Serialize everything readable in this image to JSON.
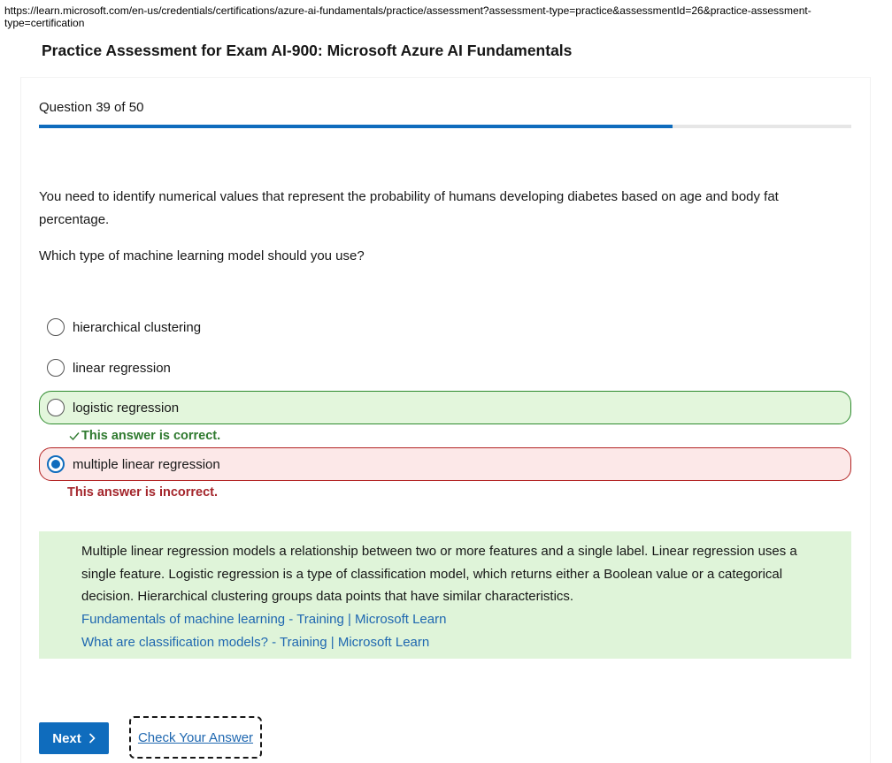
{
  "browser": {
    "url": "https://learn.microsoft.com/en-us/credentials/certifications/azure-ai-fundamentals/practice/assessment?assessment-type=practice&assessmentId=26&practice-assessment-type=certification"
  },
  "page": {
    "title": "Practice Assessment for Exam AI-900: Microsoft Azure AI Fundamentals"
  },
  "question": {
    "counter": "Question 39 of 50",
    "progress": 0.78,
    "text": "You need to identify numerical values that represent the probability of humans developing diabetes based on age and body fat percentage.",
    "ask": "Which type of machine learning model should you use?"
  },
  "options": [
    {
      "label": "hierarchical clustering",
      "state": "none",
      "selected": false
    },
    {
      "label": "linear regression",
      "state": "none",
      "selected": false
    },
    {
      "label": "logistic regression",
      "state": "correct",
      "selected": false
    },
    {
      "label": "multiple linear regression",
      "state": "incorrect",
      "selected": true
    }
  ],
  "feedback": {
    "correct": "This answer is correct.",
    "incorrect": "This answer is incorrect."
  },
  "explanation": {
    "text": "Multiple linear regression models a relationship between two or more features and a single label. Linear regression uses a single feature. Logistic regression is a type of classification model, which returns either a Boolean value or a categorical decision. Hierarchical clustering groups data points that have similar characteristics.",
    "links": [
      "Fundamentals of machine learning - Training | Microsoft Learn",
      "What are classification models? - Training | Microsoft Learn"
    ]
  },
  "actions": {
    "next_label": "Next",
    "check_label": "Check Your Answer"
  },
  "colors": {
    "accent": "#0f6cbd",
    "correct_bg": "#e3f6dc",
    "correct_border": "#2e8b2e",
    "incorrect_bg": "#fce8e8",
    "incorrect_border": "#b22222",
    "explanation_bg": "#dff4d9",
    "link": "#1e67b0"
  },
  "icons": {
    "correct": "checkmark-icon",
    "next": "chevron-right-icon"
  }
}
